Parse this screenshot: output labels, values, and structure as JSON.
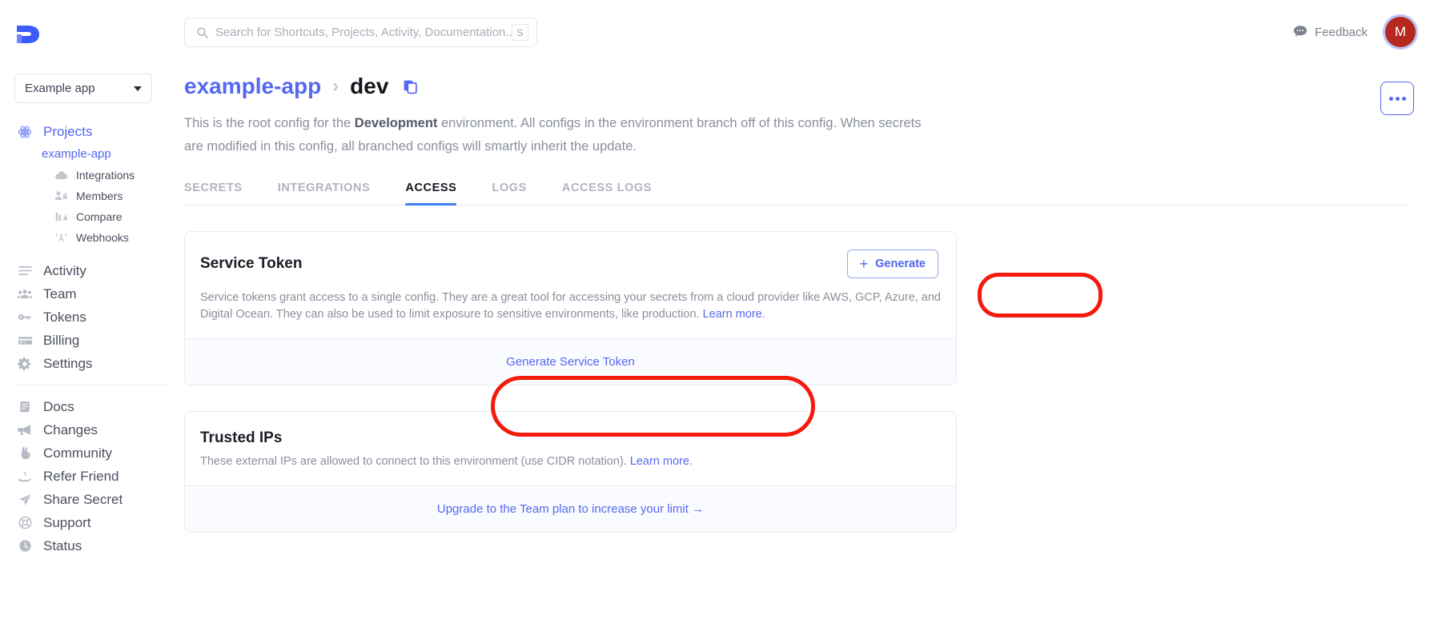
{
  "brand": {
    "accent": "#5468f0",
    "active_tab": "#3f7ff2",
    "annotation": "#f21b0c",
    "avatar_bg": "#b5281d"
  },
  "sidebar": {
    "logo_name": "doppler-logo",
    "app_selector": {
      "value": "Example app",
      "icon": "chevron-down-icon"
    },
    "items": [
      {
        "label": "Projects",
        "icon": "atom-icon",
        "accent": true
      },
      {
        "label": "example-app",
        "icon": "",
        "level": "sub"
      },
      {
        "label": "Integrations",
        "icon": "cloud-icon",
        "level": "sub2"
      },
      {
        "label": "Members",
        "icon": "members-lock-icon",
        "level": "sub2"
      },
      {
        "label": "Compare",
        "icon": "compare-icon",
        "level": "sub2"
      },
      {
        "label": "Webhooks",
        "icon": "webhook-antenna-icon",
        "level": "sub2"
      },
      {
        "label": "Activity",
        "icon": "list-icon"
      },
      {
        "label": "Team",
        "icon": "people-icon"
      },
      {
        "label": "Tokens",
        "icon": "key-icon"
      },
      {
        "label": "Billing",
        "icon": "credit-card-icon"
      },
      {
        "label": "Settings",
        "icon": "gear-icon"
      }
    ],
    "footer_items": [
      {
        "label": "Docs",
        "icon": "book-icon"
      },
      {
        "label": "Changes",
        "icon": "megaphone-icon"
      },
      {
        "label": "Community",
        "icon": "hand-peace-icon"
      },
      {
        "label": "Refer Friend",
        "icon": "hand-dollar-icon"
      },
      {
        "label": "Share Secret",
        "icon": "paper-plane-icon"
      },
      {
        "label": "Support",
        "icon": "lifebuoy-icon"
      },
      {
        "label": "Status",
        "icon": "clock-icon"
      }
    ]
  },
  "topbar": {
    "search": {
      "placeholder": "Search for Shortcuts, Projects, Activity, Documentation...",
      "value": "",
      "icon": "search-icon",
      "shortcut_key": "S"
    },
    "feedback": {
      "label": "Feedback",
      "icon": "chat-bubble-icon"
    },
    "avatar": {
      "initial": "M"
    }
  },
  "header": {
    "breadcrumb": {
      "project": "example-app",
      "separator": "›",
      "config": "dev",
      "copy_icon": "copy-icon"
    },
    "description_prefix": "This is the root config for the ",
    "description_bold": "Development",
    "description_suffix": " environment. All configs in the environment branch off of this config. When secrets are modified in this config, all branched configs will smartly inherit the update.",
    "overflow_menu": "ellipsis-icon"
  },
  "tabs": [
    {
      "label": "SECRETS",
      "active": false
    },
    {
      "label": "INTEGRATIONS",
      "active": false
    },
    {
      "label": "ACCESS",
      "active": true
    },
    {
      "label": "LOGS",
      "active": false
    },
    {
      "label": "ACCESS LOGS",
      "active": false
    }
  ],
  "service_token_card": {
    "title": "Service Token",
    "generate_button": {
      "label": "Generate",
      "icon": "plus-icon"
    },
    "body_text": "Service tokens grant access to a single config. They are a great tool for accessing your secrets from a cloud provider like AWS, GCP, Azure, and Digital Ocean. They can also be used to limit exposure to sensitive environments, like production. ",
    "body_link": "Learn more",
    "body_period": ".",
    "footer_action": "Generate Service Token"
  },
  "trusted_ips_card": {
    "title": "Trusted IPs",
    "body_text": "These external IPs are allowed to connect to this environment (use CIDR notation). ",
    "body_link": "Learn more",
    "body_period": ".",
    "footer_action": "Upgrade to the Team plan to increase your limit →"
  }
}
